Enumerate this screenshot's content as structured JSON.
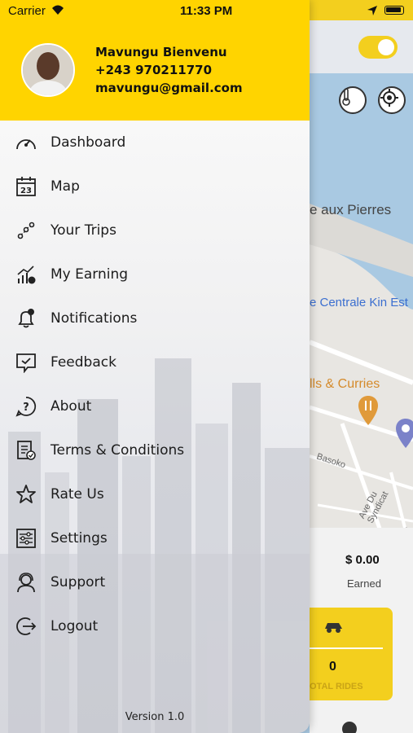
{
  "status_bar": {
    "carrier": "Carrier",
    "time": "11:33 PM"
  },
  "profile": {
    "name": "Mavungu Bienvenu",
    "phone": "+243 970211770",
    "email": "mavungu@gmail.com"
  },
  "menu": {
    "items": [
      {
        "label": "Dashboard",
        "icon": "speedometer-icon"
      },
      {
        "label": "Map",
        "icon": "calendar-icon"
      },
      {
        "label": "Your Trips",
        "icon": "route-icon"
      },
      {
        "label": "My Earning",
        "icon": "chart-icon"
      },
      {
        "label": "Notifications",
        "icon": "bell-icon"
      },
      {
        "label": "Feedback",
        "icon": "feedback-icon"
      },
      {
        "label": "About",
        "icon": "question-icon"
      },
      {
        "label": "Terms & Conditions",
        "icon": "document-icon"
      },
      {
        "label": "Rate Us",
        "icon": "star-icon"
      },
      {
        "label": "Settings",
        "icon": "sliders-icon"
      },
      {
        "label": "Support",
        "icon": "headset-icon"
      },
      {
        "label": "Logout",
        "icon": "logout-icon"
      }
    ],
    "calendar_day": "23"
  },
  "version": "Version 1.0",
  "map": {
    "labels": [
      "e aux Pierres",
      "e Centrale Kin Est",
      "lls & Curries",
      "Basoko",
      "Ave Du Syndicat",
      "Av"
    ],
    "earned_value": "$ 0.00",
    "earned_label": "Earned",
    "rides_value": "0",
    "rides_label": "OTAL RIDES"
  },
  "colors": {
    "accent": "#ffd400",
    "map_water": "#a8c8e0"
  }
}
